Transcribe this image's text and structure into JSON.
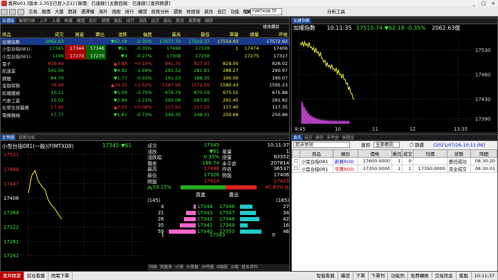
{
  "window": {
    "title": "富邦e01 [版本 2.35][已登入][1] [報價：已連線] [主動回報：已連線] [富邦精選]",
    "controls": [
      "_",
      "□",
      "×"
    ]
  },
  "menu": {
    "items": [
      "交易",
      "報價",
      "大盤",
      "期貨",
      "選擇權",
      "海外",
      "個股",
      "排行",
      "權證",
      "技術分析",
      "選股",
      "財經報",
      "資訊",
      "自訂",
      "功能",
      "說明"
    ],
    "code_label": "代碼",
    "code_value": "FIMTX08.TF",
    "analysis_label": "分析工具"
  },
  "quote_panel": {
    "tabs": [
      "自選股",
      "報價列表",
      "上市",
      "上櫃",
      "興櫃",
      "權證",
      "統計",
      "總覽",
      "類股",
      "排行",
      "漲跌",
      "成交",
      "委託",
      "期貨",
      "選擇權",
      "國際"
    ],
    "active_tab": "自選股",
    "edit_label": "修改欄目",
    "headers": [
      "商品",
      "成交",
      "買進",
      "賣出",
      "漲跌",
      "幅度",
      "最高",
      "最低",
      "單量",
      "總量",
      "昨收"
    ],
    "rows": [
      {
        "name": "加權指數",
        "last": "2062.63",
        "bid": "",
        "ask": "",
        "chg": "▼62.18",
        "pct": "-0.35%",
        "high": "17677.70",
        "low": "17502.37",
        "vol": "17554.93",
        "tvol": "",
        "prev": "17572.92",
        "c": "grn",
        "hl": true
      },
      {
        "name": "小型台指081(-",
        "last": "17345",
        "bid": "17344",
        "ask": "17346",
        "chg": "▼61",
        "pct": "-0.35%",
        "high": "17488",
        "low": "17328",
        "vol": "1",
        "tvol": "17474",
        "prev": "17406",
        "c": "grn",
        "hl": false
      },
      {
        "name": "小型台指081(-",
        "last": "1199",
        "bid": "17270",
        "ask": "17270",
        "chg": "▼4",
        "pct": "-0.27%",
        "high": "17308",
        "low": "17258",
        "vol": "",
        "tvol": "17275",
        "prev": "17317",
        "c": "grn",
        "hl": false
      },
      {
        "name": "電子",
        "last": "839.49",
        "bid": "",
        "ask": "",
        "chg": "▲0.88",
        "pct": "+0.10%",
        "high": "841.70",
        "low": "827.93",
        "vol": "829.00",
        "tvol": "",
        "prev": "826.02",
        "c": "red",
        "hl": false
      },
      {
        "name": "航運業",
        "last": "541.56",
        "bid": "",
        "ask": "",
        "chg": "▼4.92",
        "pct": "-1.69%",
        "high": "291.52",
        "low": "281.81",
        "vol": "288.27",
        "tvol": "",
        "prev": "290.97",
        "c": "grn",
        "hl": false
      },
      {
        "name": "鋼鐵",
        "last": "84.70",
        "bid": "",
        "ask": "",
        "chg": "▼1.77",
        "pct": "-0.93%",
        "high": "191.53",
        "low": "188.35",
        "vol": "190.00",
        "tvol": "",
        "prev": "190.07",
        "c": "grn",
        "hl": false
      },
      {
        "name": "金融保險",
        "last": "76.49",
        "bid": "",
        "ask": "",
        "chg": "▲24.25",
        "pct": "+1.52%",
        "high": "1587.96",
        "low": "1572.59",
        "vol": "1580.43",
        "tvol": "",
        "prev": "1595.23",
        "c": "red",
        "hl": false
      },
      {
        "name": "紡織纖維",
        "last": "10.11",
        "bid": "",
        "ask": "",
        "chg": "▼5.09",
        "pct": "-0.75%",
        "high": "676.79",
        "low": "670.59",
        "vol": "675.55",
        "tvol": "",
        "prev": "675.88",
        "c": "grn",
        "hl": false
      },
      {
        "name": "汽車工業",
        "last": "15.02",
        "bid": "",
        "ask": "",
        "chg": "▼2.89",
        "pct": "-1.21%",
        "high": "292.08",
        "low": "287.85",
        "vol": "291.45",
        "tvol": "",
        "prev": "291.82",
        "c": "grn",
        "hl": false
      },
      {
        "name": "化學生技醫療",
        "last": "17.92",
        "bid": "",
        "ask": "",
        "chg": "▲0.02",
        "pct": "+0.08%",
        "high": "117.62",
        "low": "117.25",
        "vol": "117.40",
        "tvol": "",
        "prev": "117.35",
        "c": "red",
        "hl": false
      },
      {
        "name": "電機機械",
        "last": "17.77",
        "bid": "",
        "ask": "",
        "chg": "▼1.81",
        "pct": "-0.73%",
        "high": "249.35",
        "low": "248.31",
        "vol": "250.68",
        "tvol": "",
        "prev": "250.86",
        "c": "grn",
        "hl": false
      }
    ]
  },
  "index_chart": {
    "tab": "加權指數",
    "title": "加權指數",
    "time": "10:11:35",
    "price": "17510.74",
    "change": "▼62.18",
    "pct": "-0.35%",
    "volume": "2062.63億",
    "y_labels": [
      "17530",
      "17480",
      "17430",
      "17390"
    ],
    "x_labels": [
      "8:45",
      "10",
      "11",
      "12",
      "13:35"
    ]
  },
  "chart_data": {
    "type": "line",
    "x": [
      "8:45",
      "9:00",
      "9:15",
      "9:30",
      "9:45",
      "10:00",
      "10:11"
    ],
    "series": [
      {
        "values": [
          17545,
          17540,
          17525,
          17500,
          17490,
          17470,
          17430
        ]
      }
    ],
    "ylim": [
      17380,
      17560
    ],
    "xlim": [
      "8:45",
      "13:45"
    ]
  },
  "detail_panel": {
    "tabs": [
      "走勢圖",
      "技術分析"
    ],
    "product": "小型台指081(一般)(FIMTX08)",
    "price": "17345",
    "change": "▼61",
    "time": "10:11:37",
    "y_labels": [
      "17531",
      "17488",
      "17447",
      "17406",
      "17364",
      "17322",
      "17281",
      "17241"
    ],
    "x_labels": [
      "8:45",
      "10",
      "11",
      "12",
      "13:45"
    ],
    "stats_left_labels": [
      "成交",
      "漲跌",
      "漲跌幅",
      "價差",
      "最高",
      "最低",
      "開盤"
    ],
    "stats_left_values": [
      "17345",
      "▼61",
      "-0.35%",
      "-166.74",
      "17488",
      "17328",
      "17414"
    ],
    "stats_mid_labels": [
      "單量",
      "總量",
      "未平倉",
      "昨收",
      "開盤"
    ],
    "stats_right_values": [
      "1",
      "83352",
      "207814",
      "36537",
      "17406",
      "17423"
    ],
    "inner_label": "內",
    "inner_pct": "59.15%",
    "outer_pct": "40.85%",
    "outer_label": "外",
    "book_headers": [
      "買進",
      "賣出"
    ],
    "book_totals": [
      "(145)",
      "(165)"
    ],
    "bids": [
      {
        "qty": "4",
        "price": "17344"
      },
      {
        "qty": "21",
        "price": "17343"
      },
      {
        "qty": "26",
        "price": "17342"
      },
      {
        "qty": "35",
        "price": "17341"
      },
      {
        "qty": "59",
        "price": "17340"
      }
    ],
    "asks": [
      {
        "qty": "27",
        "price": "17346"
      },
      {
        "qty": "34",
        "price": "17347"
      },
      {
        "qty": "42",
        "price": "17348"
      },
      {
        "qty": "16",
        "price": "17349"
      },
      {
        "qty": "46",
        "price": "17350"
      }
    ],
    "bottom_left": "1",
    "bottom_price": "17343",
    "bottom_right": "0",
    "bottom_tabs": [
      "明細",
      "價量表",
      "分價",
      "分價量",
      "分時量",
      "K線圖",
      "五檔",
      "基本資料"
    ]
  },
  "order_panel": {
    "tabs": [
      "委託",
      "成交",
      "庫存",
      "未平倉",
      "保證金"
    ],
    "account_placeholder": "期貨帳號",
    "query_label": "查詢",
    "filter_value": "全部委託",
    "checkbox_label": "篩選",
    "date_label": "[2021/07/26-10:11:06]",
    "headers": [
      "商品",
      "類別",
      "價格",
      "委託",
      "成交",
      "均價",
      "狀態",
      "時間"
    ],
    "rows": [
      {
        "product": "小型台指081",
        "type": "新買ROD",
        "price": "17600.0000",
        "qty": "1",
        "fill": "0",
        "avg": "",
        "status": "委託成功",
        "time": "08:30:20"
      },
      {
        "product": "小型台指081",
        "type": "平賣ROD",
        "price": "17350.0000",
        "qty": "1",
        "fill": "1",
        "avg": "17350.0000",
        "status": "完全成交",
        "time": "08:30:01"
      }
    ]
  },
  "statusbar": {
    "items": [
      "富邦精選",
      "綜合看盤",
      "閃電下單"
    ],
    "right_items": [
      "智能看盤",
      "權證",
      "下單",
      "下單列",
      "功能列",
      "免費轉帳",
      "交易訊息",
      "客服",
      "10:11:37"
    ]
  }
}
